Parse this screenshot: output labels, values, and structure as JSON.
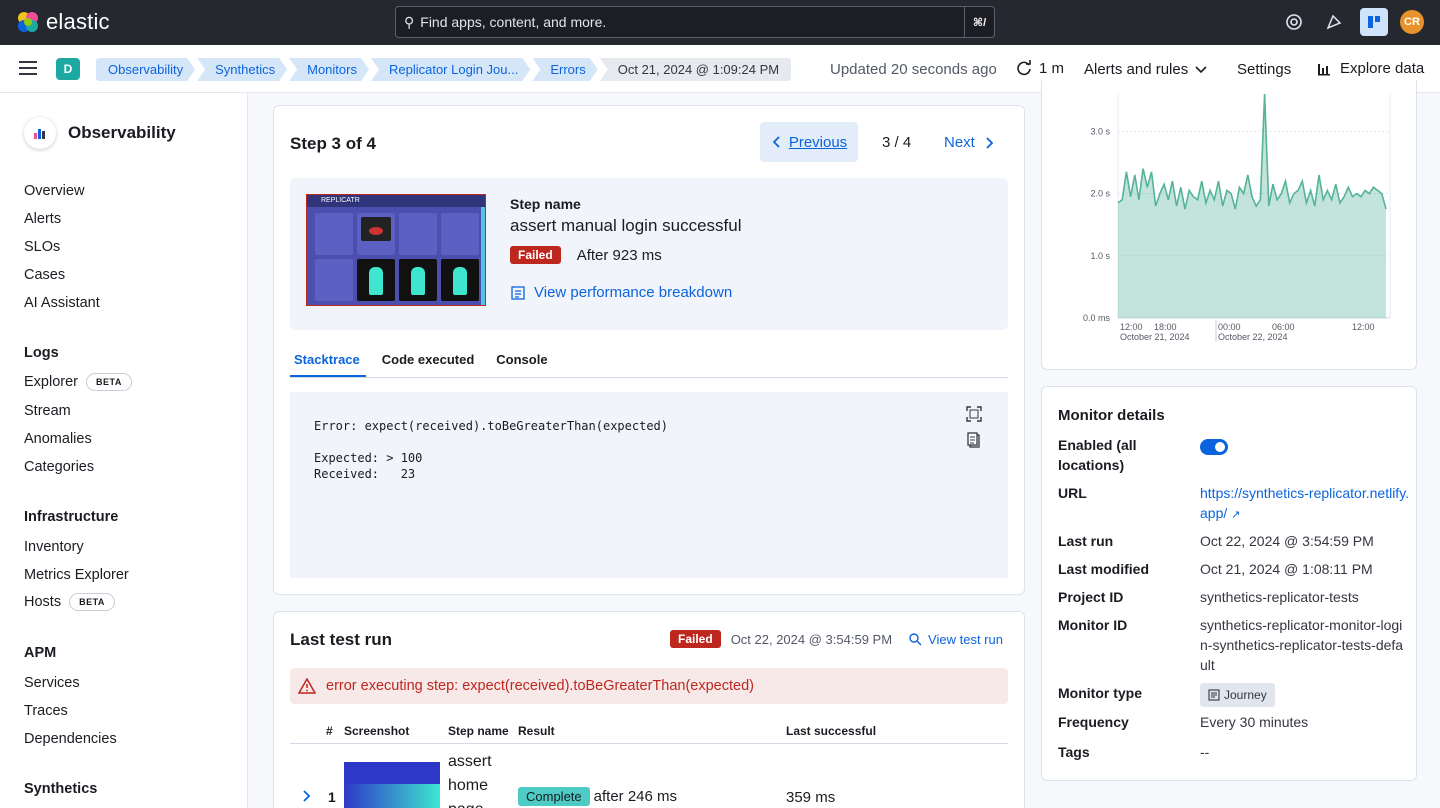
{
  "header": {
    "brand": "elastic",
    "search_placeholder": "Find apps, content, and more.",
    "search_shortcut": "⌘/",
    "avatar_initials": "CR"
  },
  "subbar": {
    "space_letter": "D",
    "breadcrumbs": [
      "Observability",
      "Synthetics",
      "Monitors",
      "Replicator Login Jou...",
      "Errors",
      "Oct 21, 2024 @ 1:09:24 PM"
    ],
    "updated": "Updated 20 seconds ago",
    "refresh_interval": "1 m",
    "alerts_rules": "Alerts and rules",
    "settings": "Settings",
    "explore_data": "Explore data"
  },
  "sidebar": {
    "title": "Observability",
    "top_items": [
      "Overview",
      "Alerts",
      "SLOs",
      "Cases",
      "AI Assistant"
    ],
    "groups": [
      {
        "label": "Logs",
        "items": [
          "Explorer",
          "Stream",
          "Anomalies",
          "Categories"
        ]
      },
      {
        "label": "Infrastructure",
        "items": [
          "Inventory",
          "Metrics Explorer",
          "Hosts"
        ]
      },
      {
        "label": "APM",
        "items": [
          "Services",
          "Traces",
          "Dependencies"
        ]
      },
      {
        "label": "Synthetics",
        "items": []
      }
    ],
    "beta_label": "BETA"
  },
  "step": {
    "title": "Step 3 of 4",
    "previous": "Previous",
    "pager": "3 / 4",
    "next": "Next",
    "name_label": "Step name",
    "name_value": "assert manual login successful",
    "status": "Failed",
    "duration": "After 923 ms",
    "perf_link": "View performance breakdown",
    "thumb_brand": "REPLICATR",
    "tabs": [
      "Stacktrace",
      "Code executed",
      "Console"
    ],
    "stacktrace": "Error: expect(received).toBeGreaterThan(expected)\n\nExpected: > 100\nReceived:   23"
  },
  "last_test_run": {
    "title": "Last test run",
    "status": "Failed",
    "timestamp": "Oct 22, 2024 @ 3:54:59 PM",
    "view_link": "View test run",
    "error": "error executing step: expect(received).toBeGreaterThan(expected)",
    "columns": [
      "#",
      "Screenshot",
      "Step name",
      "Result",
      "Last successful"
    ],
    "rows": [
      {
        "num": "1",
        "step_name_lines": [
          "assert",
          "home",
          "page"
        ],
        "result": "Complete",
        "duration": "after 246 ms",
        "last_successful": "359 ms"
      }
    ]
  },
  "chart_data": {
    "type": "area",
    "ylabel": "",
    "y_ticks": [
      "0.0 ms",
      "1.0 s",
      "2.0 s",
      "3.0 s"
    ],
    "ylim": [
      0,
      3.6
    ],
    "x_tick_labels": [
      "12:00",
      "18:00",
      "00:00",
      "06:00",
      "12:00"
    ],
    "x_date_labels": [
      "October 21, 2024",
      "October 22, 2024"
    ],
    "values": [
      1.85,
      1.9,
      2.35,
      1.95,
      2.3,
      1.9,
      2.4,
      2.1,
      2.35,
      1.8,
      2.0,
      2.15,
      1.9,
      2.2,
      1.8,
      2.1,
      1.75,
      2.05,
      1.95,
      1.9,
      2.2,
      1.85,
      2.05,
      1.9,
      2.2,
      1.8,
      2.05,
      2.0,
      1.75,
      2.1,
      2.0,
      2.3,
      1.95,
      1.8,
      1.9,
      3.6,
      1.8,
      2.15,
      1.9,
      2.0,
      2.2,
      1.85,
      2.0,
      2.05,
      2.2,
      1.85,
      2.05,
      1.8,
      2.3,
      1.9,
      2.05,
      1.9,
      2.15,
      1.85,
      1.95,
      2.1,
      1.95,
      2.0,
      1.95,
      2.05,
      2.0,
      2.1,
      2.05,
      2.0,
      1.75
    ],
    "color": "#54b399"
  },
  "monitor_details": {
    "title": "Monitor details",
    "enabled_label": "Enabled (all locations)",
    "url_label": "URL",
    "url_value": "https://synthetics-replicator.netlify.app/",
    "last_run_label": "Last run",
    "last_run": "Oct 22, 2024 @ 3:54:59 PM",
    "last_modified_label": "Last modified",
    "last_modified": "Oct 21, 2024 @ 1:08:11 PM",
    "project_id_label": "Project ID",
    "project_id": "synthetics-replicator-tests",
    "monitor_id_label": "Monitor ID",
    "monitor_id": "synthetics-replicator-monitor-login-synthetics-replicator-tests-default",
    "monitor_type_label": "Monitor type",
    "monitor_type": "Journey",
    "frequency_label": "Frequency",
    "frequency": "Every 30 minutes",
    "tags_label": "Tags",
    "tags": "--"
  }
}
